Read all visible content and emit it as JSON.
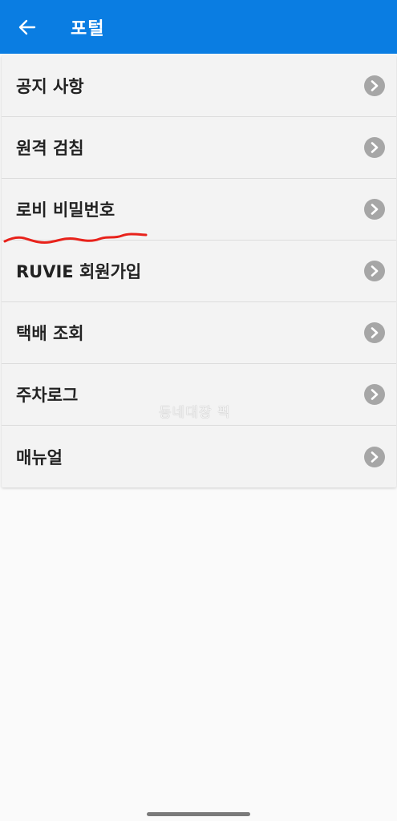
{
  "app_bar": {
    "title": "포털",
    "back_icon": "arrow-left-icon",
    "color": "#0a7de2"
  },
  "menu": {
    "items": [
      {
        "label": "공지 사항"
      },
      {
        "label": "원격 검침"
      },
      {
        "label": "로비 비밀번호"
      },
      {
        "label": "RUVIE 회원가입"
      },
      {
        "label": "택배 조회"
      },
      {
        "label": "주차로그"
      },
      {
        "label": "매뉴얼"
      }
    ],
    "chevron_icon": "chevron-right-circle-icon"
  },
  "watermark": "동네대장 픽",
  "annotation_color": "#e8221b"
}
